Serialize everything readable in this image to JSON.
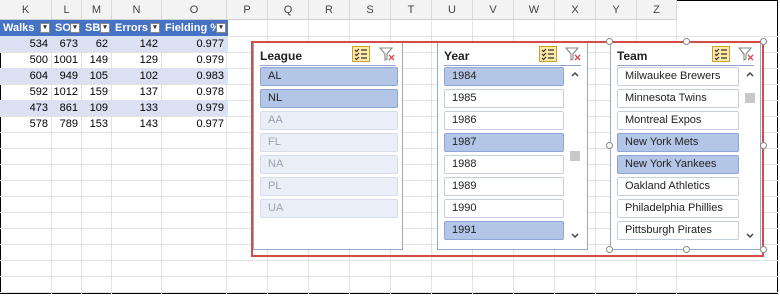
{
  "columns": [
    "K",
    "L",
    "M",
    "N",
    "O",
    "P",
    "Q",
    "R",
    "S",
    "T",
    "U",
    "V",
    "W",
    "X",
    "Y",
    "Z"
  ],
  "table": {
    "headers": [
      "Walks",
      "SO",
      "SB",
      "Errors",
      "Fielding %"
    ],
    "rows": [
      [
        "534",
        "673",
        "62",
        "142",
        "0.977"
      ],
      [
        "500",
        "1001",
        "149",
        "129",
        "0.979"
      ],
      [
        "604",
        "949",
        "105",
        "102",
        "0.983"
      ],
      [
        "592",
        "1012",
        "159",
        "137",
        "0.978"
      ],
      [
        "473",
        "861",
        "109",
        "133",
        "0.979"
      ],
      [
        "578",
        "789",
        "153",
        "143",
        "0.977"
      ]
    ]
  },
  "slicers": {
    "league": {
      "title": "League",
      "items": [
        {
          "label": "AL",
          "state": "selected"
        },
        {
          "label": "NL",
          "state": "selected"
        },
        {
          "label": "AA",
          "state": "nodata"
        },
        {
          "label": "FL",
          "state": "nodata"
        },
        {
          "label": "NA",
          "state": "nodata"
        },
        {
          "label": "PL",
          "state": "nodata"
        },
        {
          "label": "UA",
          "state": "nodata"
        }
      ]
    },
    "year": {
      "title": "Year",
      "items": [
        {
          "label": "1984",
          "state": "selected"
        },
        {
          "label": "1985",
          "state": "normal"
        },
        {
          "label": "1986",
          "state": "normal"
        },
        {
          "label": "1987",
          "state": "selected"
        },
        {
          "label": "1988",
          "state": "normal"
        },
        {
          "label": "1989",
          "state": "normal"
        },
        {
          "label": "1990",
          "state": "normal"
        },
        {
          "label": "1991",
          "state": "selected"
        }
      ]
    },
    "team": {
      "title": "Team",
      "items": [
        {
          "label": "Milwaukee Brewers",
          "state": "normal"
        },
        {
          "label": "Minnesota Twins",
          "state": "normal"
        },
        {
          "label": "Montreal Expos",
          "state": "normal"
        },
        {
          "label": "New York Mets",
          "state": "selected"
        },
        {
          "label": "New York Yankees",
          "state": "selected"
        },
        {
          "label": "Oakland Athletics",
          "state": "normal"
        },
        {
          "label": "Philadelphia Phillies",
          "state": "normal"
        },
        {
          "label": "Pittsburgh Pirates",
          "state": "normal"
        }
      ]
    }
  },
  "icons": {
    "multi_select": "multi-select-icon",
    "clear_filter": "clear-filter-icon",
    "scroll_up": "chevron-up-icon",
    "scroll_down": "chevron-down-icon"
  },
  "colors": {
    "table_header": "#4472c4",
    "table_band": "#d9e1f2",
    "slicer_selected": "#b4c6e7",
    "selection_border": "#d64a4a"
  }
}
